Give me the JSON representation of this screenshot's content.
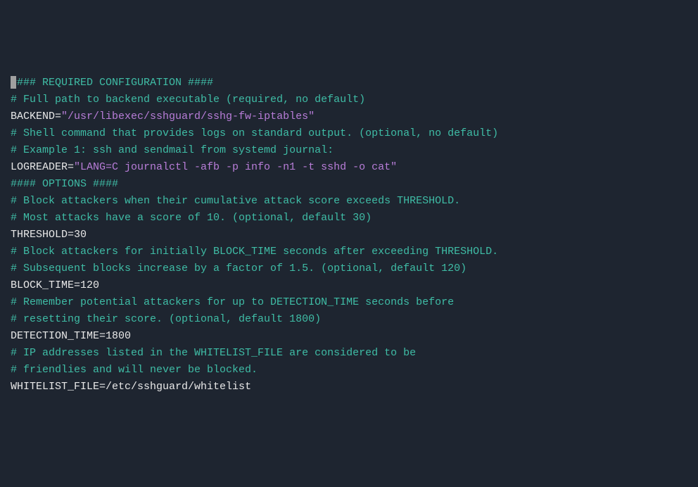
{
  "lines": [
    {
      "tokens": [
        {
          "cls": "cursor",
          "text": ""
        },
        {
          "cls": "comment",
          "text": "#### REQUIRED CONFIGURATION ####"
        }
      ]
    },
    {
      "tokens": [
        {
          "cls": "comment",
          "text": "# Full path to backend executable (required, no default)"
        }
      ]
    },
    {
      "tokens": [
        {
          "cls": "varname",
          "text": "BACKEND="
        },
        {
          "cls": "string",
          "text": "\"/usr/libexec/sshguard/sshg-fw-iptables\""
        }
      ]
    },
    {
      "tokens": [
        {
          "cls": "",
          "text": ""
        }
      ]
    },
    {
      "tokens": [
        {
          "cls": "comment",
          "text": "# Shell command that provides logs on standard output. (optional, no default)"
        }
      ]
    },
    {
      "tokens": [
        {
          "cls": "comment",
          "text": "# Example 1: ssh and sendmail from systemd journal:"
        }
      ]
    },
    {
      "tokens": [
        {
          "cls": "varname",
          "text": "LOGREADER="
        },
        {
          "cls": "string",
          "text": "\"LANG=C journalctl -afb -p info -n1 -t sshd -o cat\""
        }
      ]
    },
    {
      "tokens": [
        {
          "cls": "",
          "text": ""
        }
      ]
    },
    {
      "tokens": [
        {
          "cls": "comment",
          "text": "#### OPTIONS ####"
        }
      ]
    },
    {
      "tokens": [
        {
          "cls": "comment",
          "text": "# Block attackers when their cumulative attack score exceeds THRESHOLD."
        }
      ]
    },
    {
      "tokens": [
        {
          "cls": "comment",
          "text": "# Most attacks have a score of 10. (optional, default 30)"
        }
      ]
    },
    {
      "tokens": [
        {
          "cls": "varname",
          "text": "THRESHOLD="
        },
        {
          "cls": "value",
          "text": "30"
        }
      ]
    },
    {
      "tokens": [
        {
          "cls": "",
          "text": ""
        }
      ]
    },
    {
      "tokens": [
        {
          "cls": "comment",
          "text": "# Block attackers for initially BLOCK_TIME seconds after exceeding THRESHOLD."
        }
      ]
    },
    {
      "tokens": [
        {
          "cls": "comment",
          "text": "# Subsequent blocks increase by a factor of 1.5. (optional, default 120)"
        }
      ]
    },
    {
      "tokens": [
        {
          "cls": "varname",
          "text": "BLOCK_TIME="
        },
        {
          "cls": "value",
          "text": "120"
        }
      ]
    },
    {
      "tokens": [
        {
          "cls": "",
          "text": ""
        }
      ]
    },
    {
      "tokens": [
        {
          "cls": "comment",
          "text": "# Remember potential attackers for up to DETECTION_TIME seconds before"
        }
      ]
    },
    {
      "tokens": [
        {
          "cls": "comment",
          "text": "# resetting their score. (optional, default 1800)"
        }
      ]
    },
    {
      "tokens": [
        {
          "cls": "varname",
          "text": "DETECTION_TIME="
        },
        {
          "cls": "value",
          "text": "1800"
        }
      ]
    },
    {
      "tokens": [
        {
          "cls": "",
          "text": ""
        }
      ]
    },
    {
      "tokens": [
        {
          "cls": "comment",
          "text": "# IP addresses listed in the WHITELIST_FILE are considered to be"
        }
      ]
    },
    {
      "tokens": [
        {
          "cls": "comment",
          "text": "# friendlies and will never be blocked."
        }
      ]
    },
    {
      "tokens": [
        {
          "cls": "varname",
          "text": "WHITELIST_FILE="
        },
        {
          "cls": "value",
          "text": "/etc/sshguard/whitelist"
        }
      ]
    }
  ]
}
